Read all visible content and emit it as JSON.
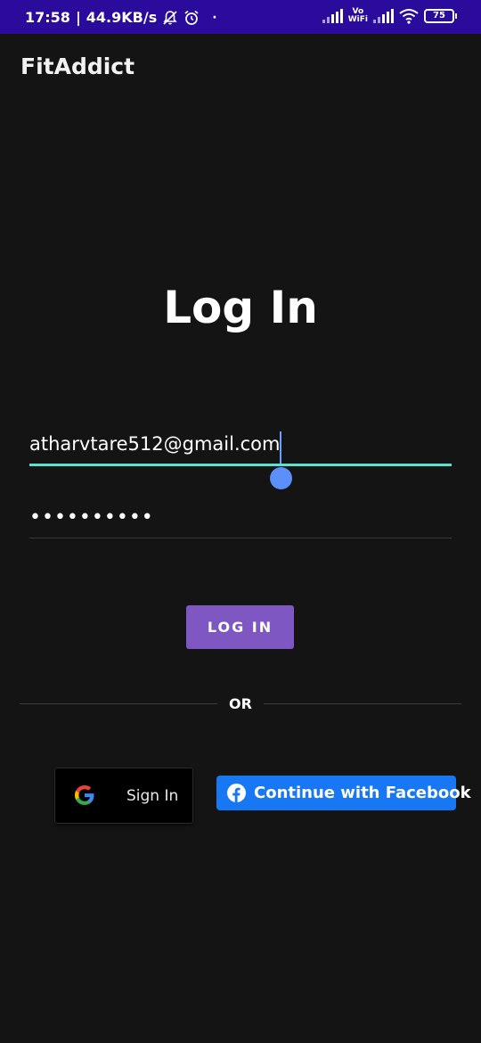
{
  "status_bar": {
    "time": "17:58",
    "network_speed": "44.9KB/s",
    "vowifi_top": "Vo",
    "vowifi_bottom": "WiFi",
    "battery": "75",
    "icons": [
      "bell-off-icon",
      "alarm-icon",
      "dot-icon",
      "signal-icon",
      "wifi-icon",
      "battery-icon"
    ]
  },
  "app": {
    "title": "FitAddict"
  },
  "login": {
    "heading": "Log In",
    "email_value": "atharvtare512@gmail.com",
    "password_value": "••••••••••",
    "button_label": "LOG IN",
    "or_label": "OR"
  },
  "social": {
    "google_label": "Sign In",
    "facebook_label": "Continue with Facebook"
  },
  "colors": {
    "status_bar": "#2a0b9c",
    "background": "#141414",
    "accent_underline": "#5ce0d0",
    "login_button": "#7e57c2",
    "facebook": "#1877f2"
  }
}
